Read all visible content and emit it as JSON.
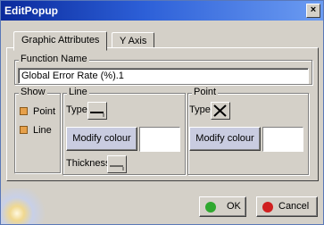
{
  "window": {
    "title": "EditPopup",
    "close_glyph": "×"
  },
  "tabs": [
    {
      "label": "Graphic Attributes",
      "active": true
    },
    {
      "label": "Y Axis",
      "active": false
    }
  ],
  "function_name": {
    "legend": "Function Name",
    "value": "Global Error Rate (%).1"
  },
  "show": {
    "legend": "Show",
    "options": [
      {
        "label": "Point",
        "checked": true
      },
      {
        "label": "Line",
        "checked": true
      }
    ]
  },
  "line": {
    "legend": "Line",
    "type_label": "Type",
    "modify_label": "Modify colour",
    "thickness_label": "Thickness"
  },
  "point": {
    "legend": "Point",
    "type_label": "Type",
    "modify_label": "Modify colour"
  },
  "footer": {
    "ok_label": "OK",
    "cancel_label": "Cancel"
  },
  "colors": {
    "ok_icon": "#2fa82f",
    "cancel_icon": "#d02020",
    "checkbox": "#e6a04a"
  }
}
